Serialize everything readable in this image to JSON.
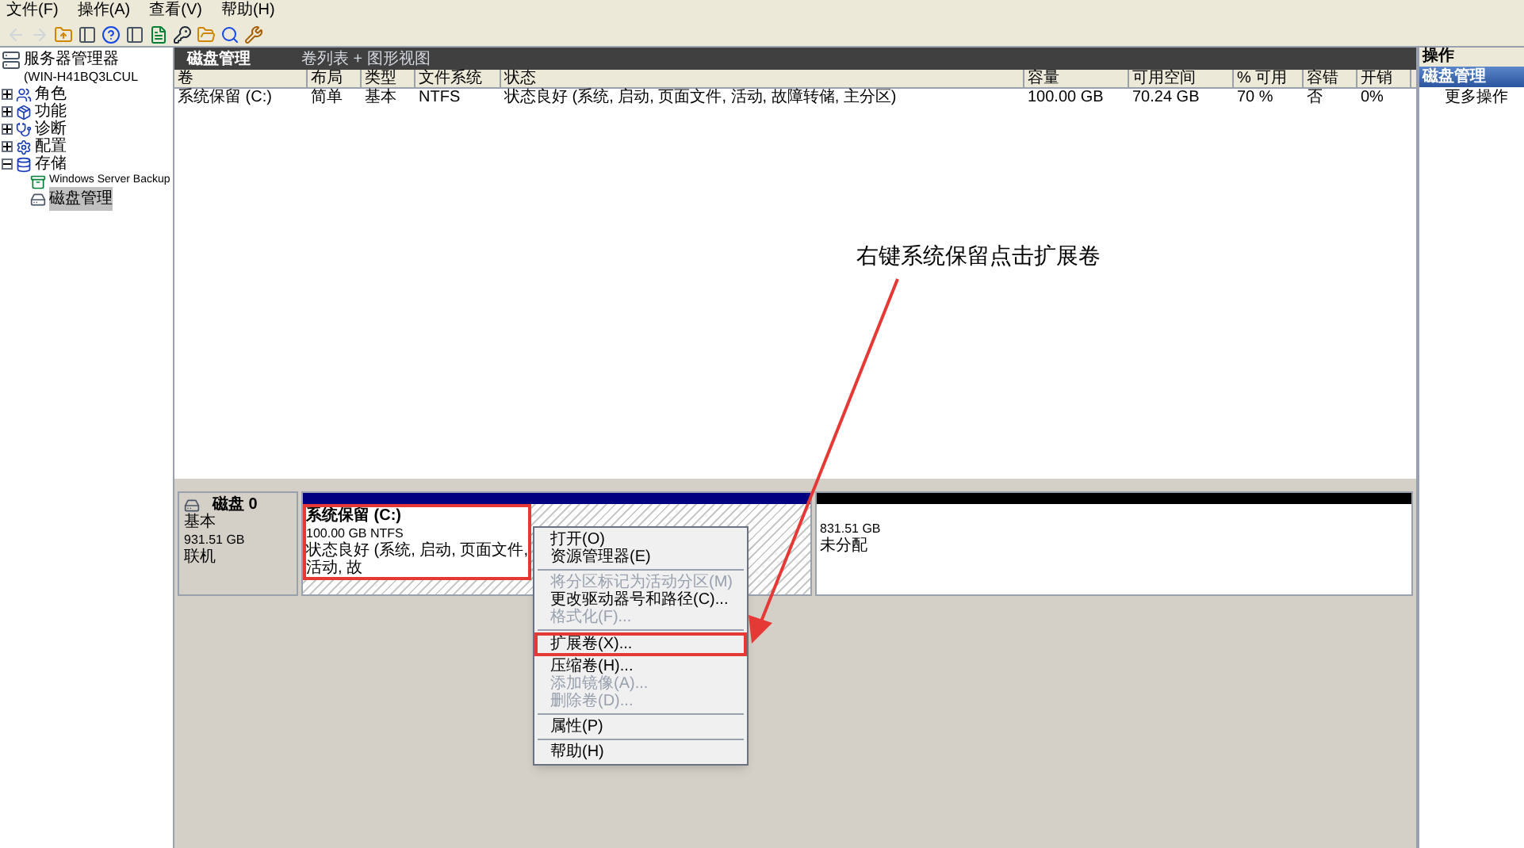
{
  "menu_bar": [
    "文件(F)",
    "操作(A)",
    "查看(V)",
    "帮助(H)"
  ],
  "toolbar": [
    {
      "kind": "back",
      "disabled": true
    },
    {
      "kind": "forward",
      "disabled": true
    },
    {
      "kind": "up",
      "disabled": false
    },
    {
      "kind": "pane",
      "disabled": false
    },
    {
      "kind": "help",
      "disabled": false
    },
    {
      "kind": "pane",
      "disabled": false
    },
    {
      "kind": "doc",
      "disabled": false
    },
    {
      "kind": "key",
      "disabled": false
    },
    {
      "kind": "folder",
      "disabled": false
    },
    {
      "kind": "search",
      "disabled": false
    },
    {
      "kind": "tool",
      "disabled": false
    }
  ],
  "tree": {
    "label": "服务器管理器",
    "host": "(WIN-H41BQ3LCUL",
    "children": [
      {
        "label": "角色",
        "expanded": false,
        "selected": false
      },
      {
        "label": "功能",
        "expanded": false,
        "selected": false
      },
      {
        "label": "诊断",
        "expanded": false,
        "selected": false
      },
      {
        "label": "配置",
        "expanded": false,
        "selected": false
      },
      {
        "label": "存储",
        "expanded": true,
        "selected": false,
        "children": [
          {
            "label": "Windows Server Backup",
            "selected": false
          },
          {
            "label": "磁盘管理",
            "selected": true
          }
        ]
      }
    ]
  },
  "header": {
    "title": "磁盘管理",
    "view": "卷列表 + 图形视图"
  },
  "table": {
    "columns": [
      "卷",
      "布局",
      "类型",
      "文件系统",
      "状态",
      "容量",
      "可用空间",
      "% 可用",
      "容错",
      "开销"
    ],
    "rows": [
      [
        "系统保留 (C:)",
        "简单",
        "基本",
        "NTFS",
        "状态良好 (系统, 启动, 页面文件, 活动, 故障转储, 主分区)",
        "100.00 GB",
        "70.24 GB",
        "70 %",
        "否",
        "0%"
      ]
    ]
  },
  "disk": {
    "name": "磁盘 0",
    "type": "基本",
    "size": "931.51 GB",
    "status": "联机",
    "partitions": [
      {
        "kind": "primary",
        "name": "系统保留 (C:)",
        "detail": "100.00 GB NTFS",
        "status": "状态良好 (系统, 启动, 页面文件, 活动, 故",
        "highlighted": true
      },
      {
        "kind": "unallocated",
        "size": "831.51 GB",
        "status": "未分配",
        "highlighted": false
      }
    ]
  },
  "context_menu": [
    {
      "kind": "item",
      "label": "打开(O)",
      "disabled": false,
      "highlighted": false
    },
    {
      "kind": "item",
      "label": "资源管理器(E)",
      "disabled": false,
      "highlighted": false
    },
    {
      "kind": "separator"
    },
    {
      "kind": "item",
      "label": "将分区标记为活动分区(M)",
      "disabled": true,
      "highlighted": false
    },
    {
      "kind": "item",
      "label": "更改驱动器号和路径(C)...",
      "disabled": false,
      "highlighted": false
    },
    {
      "kind": "item",
      "label": "格式化(F)...",
      "disabled": true,
      "highlighted": false
    },
    {
      "kind": "separator"
    },
    {
      "kind": "item",
      "label": "扩展卷(X)...",
      "disabled": false,
      "highlighted": true
    },
    {
      "kind": "item",
      "label": "压缩卷(H)...",
      "disabled": false,
      "highlighted": false
    },
    {
      "kind": "item",
      "label": "添加镜像(A)...",
      "disabled": true,
      "highlighted": false
    },
    {
      "kind": "item",
      "label": "删除卷(D)...",
      "disabled": true,
      "highlighted": false
    },
    {
      "kind": "separator"
    },
    {
      "kind": "item",
      "label": "属性(P)",
      "disabled": false,
      "highlighted": false
    },
    {
      "kind": "separator"
    },
    {
      "kind": "item",
      "label": "帮助(H)",
      "disabled": false,
      "highlighted": false
    }
  ],
  "actions": {
    "title": "操作",
    "section": "磁盘管理",
    "items": [
      "更多操作"
    ]
  },
  "annotation": {
    "text": "右键系统保留点击扩展卷"
  }
}
